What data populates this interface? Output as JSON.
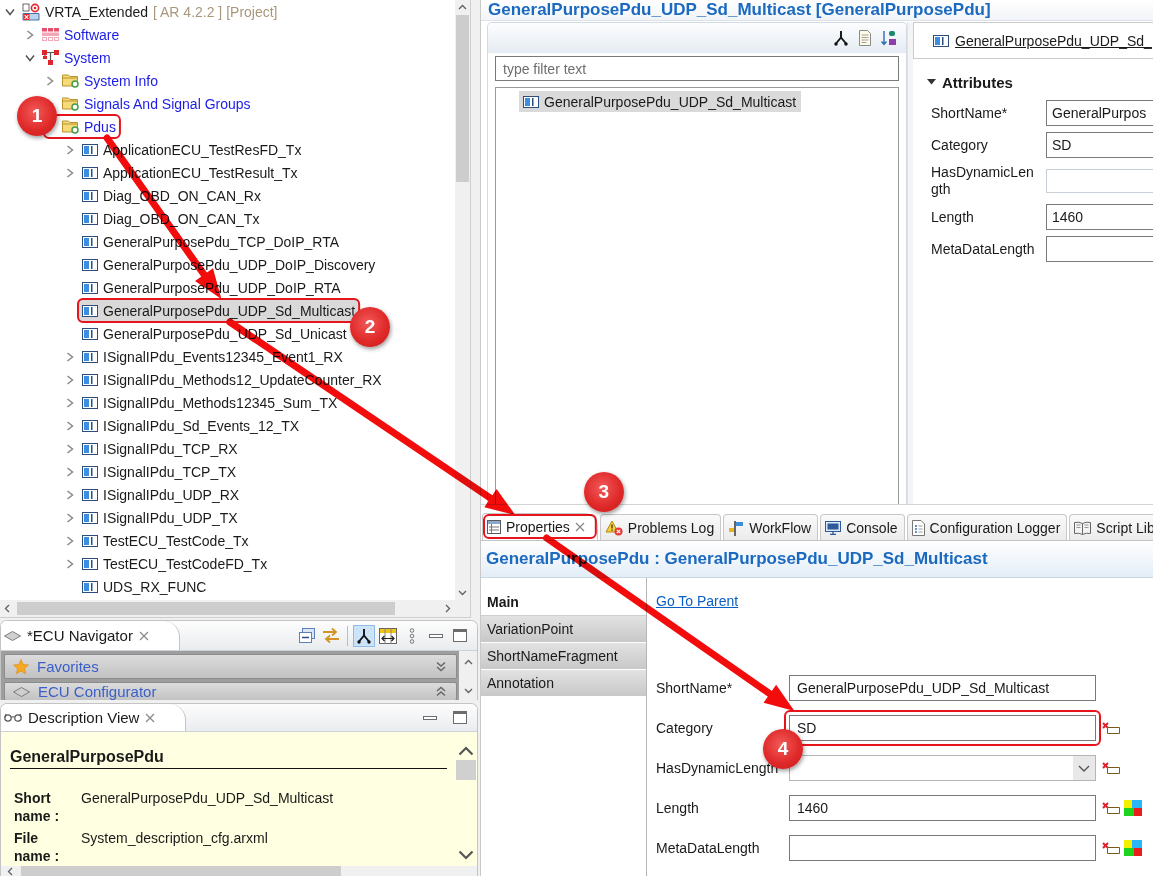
{
  "project_tree": {
    "items": [
      {
        "label": "VRTA_Extended",
        "suffix": "[ AR 4.2.2 ] [Project]",
        "kind": "project",
        "expandable": true,
        "expanded": true,
        "selected": false,
        "children": [
          {
            "label": "Software",
            "kind": "software",
            "expandable": true,
            "expanded": false,
            "selected": false
          },
          {
            "label": "System",
            "kind": "system",
            "expandable": true,
            "expanded": true,
            "selected": false,
            "children": [
              {
                "label": "System Info",
                "kind": "folder",
                "expandable": true,
                "expanded": false,
                "selected": false
              },
              {
                "label": "Signals And Signal Groups",
                "kind": "folder",
                "expandable": true,
                "expanded": false,
                "selected": false
              },
              {
                "label": "Pdus",
                "kind": "folder",
                "expandable": true,
                "expanded": true,
                "selected": false,
                "callout": "1",
                "children": [
                  {
                    "label": "ApplicationECU_TestResFD_Tx",
                    "kind": "pdu",
                    "expandable": true,
                    "expanded": false,
                    "selected": false
                  },
                  {
                    "label": "ApplicationECU_TestResult_Tx",
                    "kind": "pdu",
                    "expandable": true,
                    "expanded": false,
                    "selected": false
                  },
                  {
                    "label": "Diag_OBD_ON_CAN_Rx",
                    "kind": "pdu",
                    "expandable": false,
                    "selected": false
                  },
                  {
                    "label": "Diag_OBD_ON_CAN_Tx",
                    "kind": "pdu",
                    "expandable": false,
                    "selected": false
                  },
                  {
                    "label": "GeneralPurposePdu_TCP_DoIP_RTA",
                    "kind": "pdu",
                    "expandable": false,
                    "selected": false
                  },
                  {
                    "label": "GeneralPurposePdu_UDP_DoIP_Discovery",
                    "kind": "pdu",
                    "expandable": false,
                    "selected": false
                  },
                  {
                    "label": "GeneralPurposePdu_UDP_DoIP_RTA",
                    "kind": "pdu",
                    "expandable": false,
                    "selected": false
                  },
                  {
                    "label": "GeneralPurposePdu_UDP_Sd_Multicast",
                    "kind": "pdu",
                    "expandable": false,
                    "selected": true,
                    "callout": "2"
                  },
                  {
                    "label": "GeneralPurposePdu_UDP_Sd_Unicast",
                    "kind": "pdu",
                    "expandable": false,
                    "selected": false
                  },
                  {
                    "label": "ISignalIPdu_Events12345_Event1_RX",
                    "kind": "pdu",
                    "expandable": true,
                    "expanded": false,
                    "selected": false
                  },
                  {
                    "label": "ISignalIPdu_Methods12_UpdateCounter_RX",
                    "kind": "pdu",
                    "expandable": true,
                    "expanded": false,
                    "selected": false
                  },
                  {
                    "label": "ISignalIPdu_Methods12345_Sum_TX",
                    "kind": "pdu",
                    "expandable": true,
                    "expanded": false,
                    "selected": false
                  },
                  {
                    "label": "ISignalIPdu_Sd_Events_12_TX",
                    "kind": "pdu",
                    "expandable": true,
                    "expanded": false,
                    "selected": false
                  },
                  {
                    "label": "ISignalIPdu_TCP_RX",
                    "kind": "pdu",
                    "expandable": true,
                    "expanded": false,
                    "selected": false
                  },
                  {
                    "label": "ISignalIPdu_TCP_TX",
                    "kind": "pdu",
                    "expandable": true,
                    "expanded": false,
                    "selected": false
                  },
                  {
                    "label": "ISignalIPdu_UDP_RX",
                    "kind": "pdu",
                    "expandable": true,
                    "expanded": false,
                    "selected": false
                  },
                  {
                    "label": "ISignalIPdu_UDP_TX",
                    "kind": "pdu",
                    "expandable": true,
                    "expanded": false,
                    "selected": false
                  },
                  {
                    "label": "TestECU_TestCode_Tx",
                    "kind": "pdu",
                    "expandable": true,
                    "expanded": false,
                    "selected": false
                  },
                  {
                    "label": "TestECU_TestCodeFD_Tx",
                    "kind": "pdu",
                    "expandable": true,
                    "expanded": false,
                    "selected": false
                  },
                  {
                    "label": "UDS_RX_FUNC",
                    "kind": "pdu",
                    "expandable": false,
                    "selected": false
                  }
                ]
              }
            ]
          }
        ]
      }
    ]
  },
  "ecu_navigator": {
    "title": "*ECU Navigator",
    "toolbar": [
      {
        "kind": "collapse",
        "pressed": false
      },
      {
        "kind": "link",
        "pressed": false
      },
      {
        "kind": "hierarchy",
        "pressed": true
      },
      {
        "kind": "columns",
        "pressed": false
      }
    ],
    "sections": [
      {
        "label": "Favorites",
        "kind": "favorites",
        "expanded": false
      },
      {
        "label": "ECU Configurator",
        "kind": "configurator",
        "expanded": true
      }
    ]
  },
  "description_view": {
    "title": "Description View",
    "heading": "GeneralPurposePdu",
    "rows": [
      {
        "label": "Short name :",
        "value": "GeneralPurposePdu_UDP_Sd_Multicast"
      },
      {
        "label": "File name :",
        "value": "System_description_cfg.arxml"
      }
    ]
  },
  "editor": {
    "title": "GeneralPurposePdu_UDP_Sd_Multicast [GeneralPurposePdu]",
    "filter": {
      "placeholder": "type filter text"
    },
    "outline": [
      {
        "label": "GeneralPurposePdu_UDP_Sd_Multicast",
        "selected": true
      }
    ],
    "detail_link": "GeneralPurposePdu_UDP_Sd_",
    "section": {
      "title": "Attributes",
      "expanded": true
    },
    "fields": [
      {
        "label": "ShortName*",
        "kind": "text",
        "value": "GeneralPurpos"
      },
      {
        "label": "Category",
        "kind": "text",
        "value": "SD"
      },
      {
        "label": "HasDynamicLength",
        "kind": "combo"
      },
      {
        "label": "Length",
        "kind": "text",
        "value": "1460"
      },
      {
        "label": "MetaDataLength",
        "kind": "text"
      }
    ]
  },
  "properties_view": {
    "tabs": [
      {
        "label": "Properties",
        "kind": "properties",
        "selected": true,
        "callout": "3"
      },
      {
        "label": "Problems Log",
        "kind": "problems",
        "selected": false
      },
      {
        "label": "WorkFlow",
        "kind": "workflow",
        "selected": false
      },
      {
        "label": "Console",
        "kind": "console",
        "selected": false
      },
      {
        "label": "Configuration Logger",
        "kind": "logger",
        "selected": false
      },
      {
        "label": "Script Lib",
        "kind": "script",
        "selected": false
      }
    ],
    "header": "GeneralPurposePdu : GeneralPurposePdu_UDP_Sd_Multicast",
    "pages": [
      {
        "label": "Main",
        "selected": true
      },
      {
        "label": "VariationPoint",
        "selected": false
      },
      {
        "label": "ShortNameFragment",
        "selected": false
      },
      {
        "label": "Annotation",
        "selected": false
      }
    ],
    "parent_link": "Go To Parent",
    "fields": [
      {
        "label": "ShortName*",
        "kind": "text",
        "value": "GeneralPurposePdu_UDP_Sd_Multicast",
        "reset_button": false,
        "radix_button": false
      },
      {
        "label": "Category",
        "kind": "text",
        "value": "SD",
        "reset_button": true,
        "radix_button": false,
        "callout": "4"
      },
      {
        "label": "HasDynamicLength",
        "kind": "combo",
        "reset_button": true,
        "radix_button": false
      },
      {
        "label": "Length",
        "kind": "text",
        "value": "1460",
        "reset_button": true,
        "radix_button": true
      },
      {
        "label": "MetaDataLength",
        "kind": "text",
        "reset_button": true,
        "radix_button": true
      }
    ]
  }
}
